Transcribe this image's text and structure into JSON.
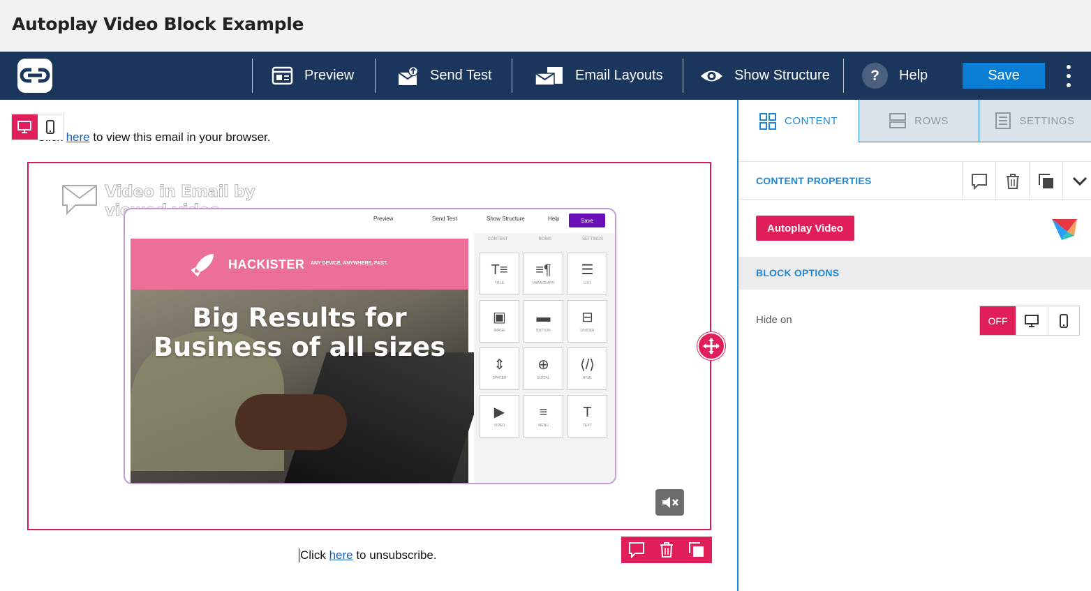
{
  "page": {
    "title": "Autoplay Video Block Example"
  },
  "toolbar": {
    "preview": "Preview",
    "send_test": "Send Test",
    "email_layouts": "Email Layouts",
    "show_structure": "Show Structure",
    "help": "Help",
    "help_glyph": "?",
    "save": "Save"
  },
  "canvas": {
    "browser_pre": "Click ",
    "browser_link": "here",
    "browser_post": " to view this email in your browser.",
    "unsub_pre": "Click ",
    "unsub_link": "here",
    "unsub_post": " to unsubscribe.",
    "video": {
      "watermark": "Video in Email by viewed.video",
      "watermark_line1": "Video in Email by",
      "watermark_line2": "viewed.video",
      "mock_toolbar": [
        "Preview",
        "Send Test",
        "Show Structure",
        "Help"
      ],
      "mock_save": "Save",
      "mock_tabs": [
        "CONTENT",
        "ROWS",
        "SETTINGS"
      ],
      "brand": "HACKISTER",
      "tagline": "ANY DEVICE, ANYWHERE, FAST.",
      "headline_line1": "Big Results for",
      "headline_line2": "Business of all sizes",
      "tiles": [
        {
          "glyph": "T≡",
          "label": "TITLE"
        },
        {
          "glyph": "≡¶",
          "label": "PARAGRAPH"
        },
        {
          "glyph": "☰",
          "label": "LIST"
        },
        {
          "glyph": "▣",
          "label": "IMAGE"
        },
        {
          "glyph": "▬",
          "label": "BUTTON"
        },
        {
          "glyph": "⊟",
          "label": "DIVIDER"
        },
        {
          "glyph": "⇕",
          "label": "SPACER"
        },
        {
          "glyph": "⊕",
          "label": "SOCIAL"
        },
        {
          "glyph": "⟨/⟩",
          "label": "HTML"
        },
        {
          "glyph": "▶",
          "label": "VIDEO"
        },
        {
          "glyph": "≡",
          "label": "MENU"
        },
        {
          "glyph": "T",
          "label": "TEXT"
        }
      ]
    }
  },
  "panel": {
    "tabs": [
      "CONTENT",
      "ROWS",
      "SETTINGS"
    ],
    "content_properties": "CONTENT PROPERTIES",
    "badge": "Autoplay Video",
    "block_options": "BLOCK OPTIONS",
    "hide_on_label": "Hide on",
    "hide_off": "OFF"
  },
  "colors": {
    "navy": "#1b365d",
    "accent": "#e01f5a",
    "blue": "#1e88d6",
    "save_blue": "#0b7fd6"
  }
}
